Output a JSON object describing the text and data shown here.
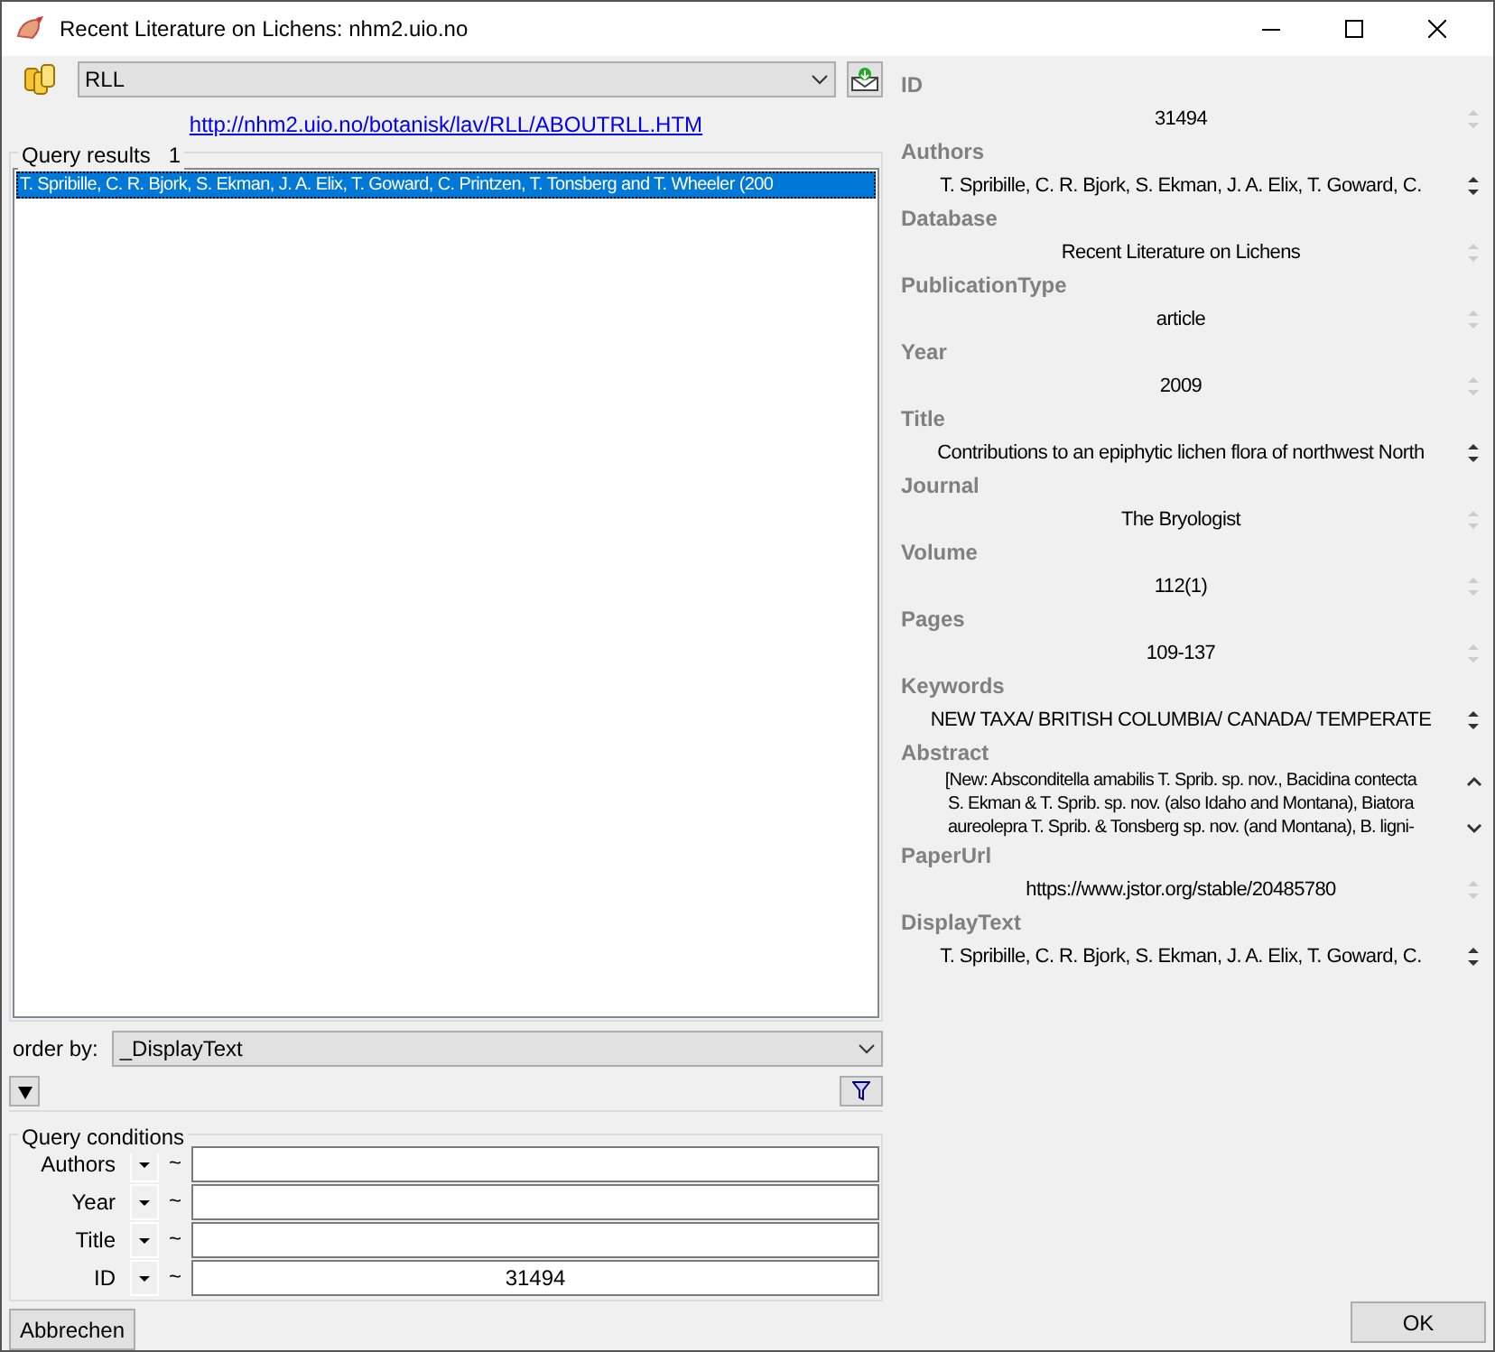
{
  "window": {
    "title": "Recent Literature on Lichens: nhm2.uio.no"
  },
  "database_select": {
    "value": "RLL"
  },
  "link": "http://nhm2.uio.no/botanisk/lav/RLL/ABOUTRLL.HTM",
  "query_results": {
    "label": "Query results",
    "count": "1",
    "rows": [
      {
        "text": "T. Spribille, C. R. Bjork, S. Ekman, J. A. Elix, T. Goward, C. Printzen, T. Tonsberg and T. Wheeler (200",
        "selected": true
      }
    ]
  },
  "order_by": {
    "label": "order by:",
    "value": "_DisplayText"
  },
  "query_conditions": {
    "label": "Query conditions",
    "rows": [
      {
        "label": "Authors",
        "operator": "~",
        "value": ""
      },
      {
        "label": "Year",
        "operator": "~",
        "value": ""
      },
      {
        "label": "Title",
        "operator": "~",
        "value": ""
      },
      {
        "label": "ID",
        "operator": "~",
        "value": "31494"
      }
    ]
  },
  "fields": [
    {
      "label": "ID",
      "kind": "single",
      "lines": [
        "31494"
      ],
      "scrollable": false
    },
    {
      "label": "Authors",
      "kind": "single",
      "lines": [
        "T. Spribille, C. R. Bjork, S. Ekman, J. A. Elix, T. Goward, C."
      ],
      "scrollable": true
    },
    {
      "label": "Database",
      "kind": "single",
      "lines": [
        "Recent Literature on Lichens"
      ],
      "scrollable": false
    },
    {
      "label": "PublicationType",
      "kind": "single",
      "lines": [
        "article"
      ],
      "scrollable": false
    },
    {
      "label": "Year",
      "kind": "single",
      "lines": [
        "2009"
      ],
      "scrollable": false
    },
    {
      "label": "Title",
      "kind": "single",
      "lines": [
        "Contributions to an epiphytic lichen flora of northwest North"
      ],
      "scrollable": true
    },
    {
      "label": "Journal",
      "kind": "single",
      "lines": [
        "The Bryologist"
      ],
      "scrollable": false
    },
    {
      "label": "Volume",
      "kind": "single",
      "lines": [
        "112(1)"
      ],
      "scrollable": false
    },
    {
      "label": "Pages",
      "kind": "single",
      "lines": [
        "109-137"
      ],
      "scrollable": false
    },
    {
      "label": "Keywords",
      "kind": "single",
      "lines": [
        "NEW TAXA/ BRITISH COLUMBIA/ CANADA/ TEMPERATE"
      ],
      "scrollable": true
    },
    {
      "label": "Abstract",
      "kind": "multi",
      "lines": [
        "[New: Absconditella amabilis T. Sprib. sp. nov., Bacidina contecta",
        "S. Ekman & T. Sprib. sp. nov. (also Idaho and Montana), Biatora",
        "aureolepra T. Sprib. & Tonsberg sp. nov. (and Montana), B. ligni-"
      ],
      "scrollable": true
    },
    {
      "label": "PaperUrl",
      "kind": "single",
      "lines": [
        "https://www.jstor.org/stable/20485780"
      ],
      "scrollable": false
    },
    {
      "label": "DisplayText",
      "kind": "single",
      "lines": [
        "T. Spribille, C. R. Bjork, S. Ekman, J. A. Elix, T. Goward, C."
      ],
      "scrollable": true
    }
  ],
  "buttons": {
    "cancel": "Abbrechen",
    "ok": "OK"
  }
}
